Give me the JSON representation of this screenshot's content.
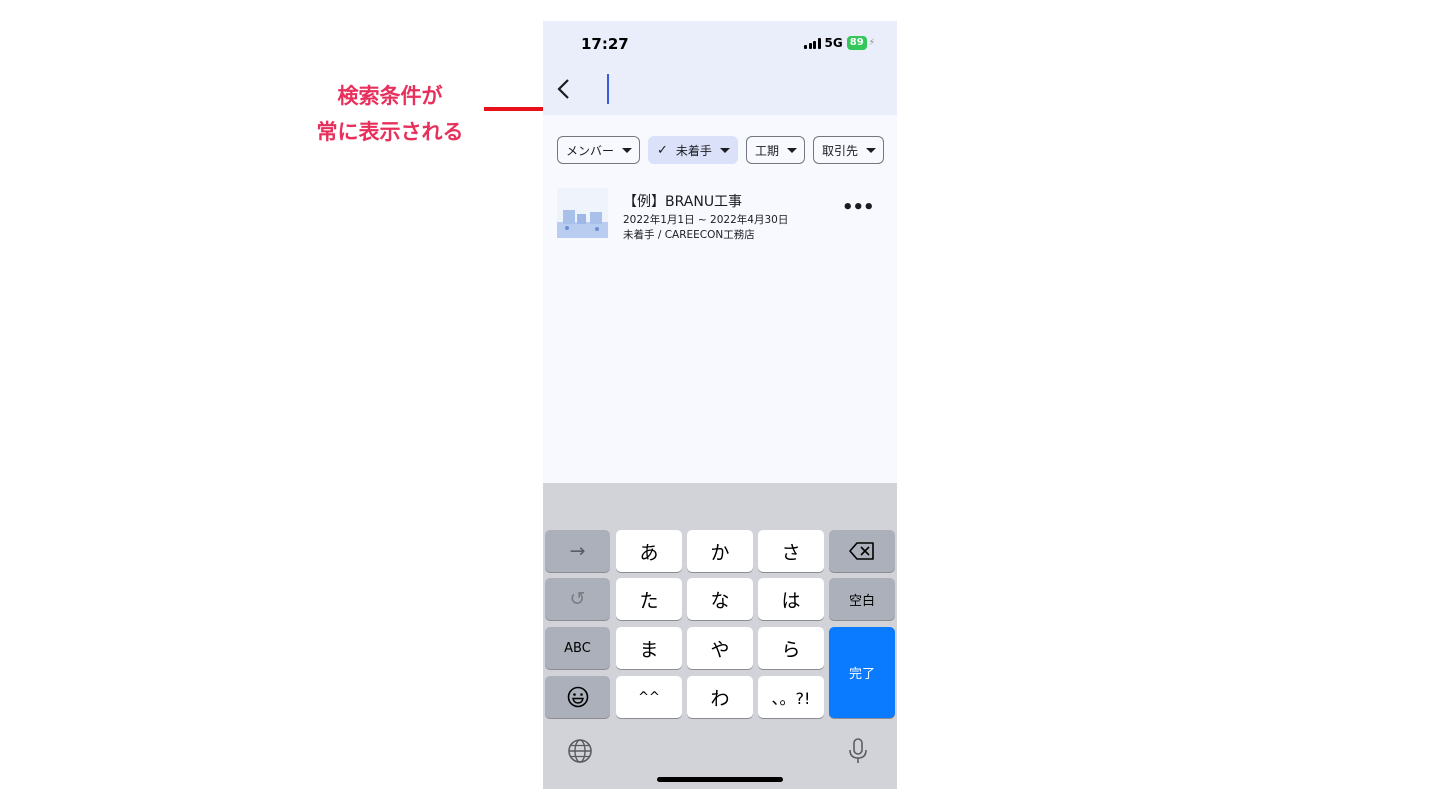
{
  "annotation": {
    "line1": "検索条件が",
    "line2": "常に表示される",
    "color": "#e8305c"
  },
  "status_bar": {
    "time": "17:27",
    "network": "5G",
    "battery": "89"
  },
  "search": {
    "value": "",
    "placeholder": ""
  },
  "filters": [
    {
      "label": "メンバー",
      "selected": false
    },
    {
      "label": "未着手",
      "selected": true
    },
    {
      "label": "工期",
      "selected": false
    },
    {
      "label": "取引先",
      "selected": false
    }
  ],
  "project": {
    "title": "【例】BRANU工事",
    "dates": "2022年1月1日 ~ 2022年4月30日",
    "status": "未着手 / CAREECON工務店",
    "more": "•••"
  },
  "keyboard": {
    "row1": [
      "→",
      "あ",
      "か",
      "さ"
    ],
    "row2": [
      "た",
      "な",
      "は",
      "空白"
    ],
    "row3": [
      "ABC",
      "ま",
      "や",
      "ら"
    ],
    "row4": [
      "^^",
      "わ",
      "、。?!"
    ],
    "undo": "↺",
    "done": "完了"
  },
  "colors": {
    "accent": "#0a7aff",
    "chip_selected": "#dbe1f9",
    "annotation_arrow": "#e8101a"
  }
}
